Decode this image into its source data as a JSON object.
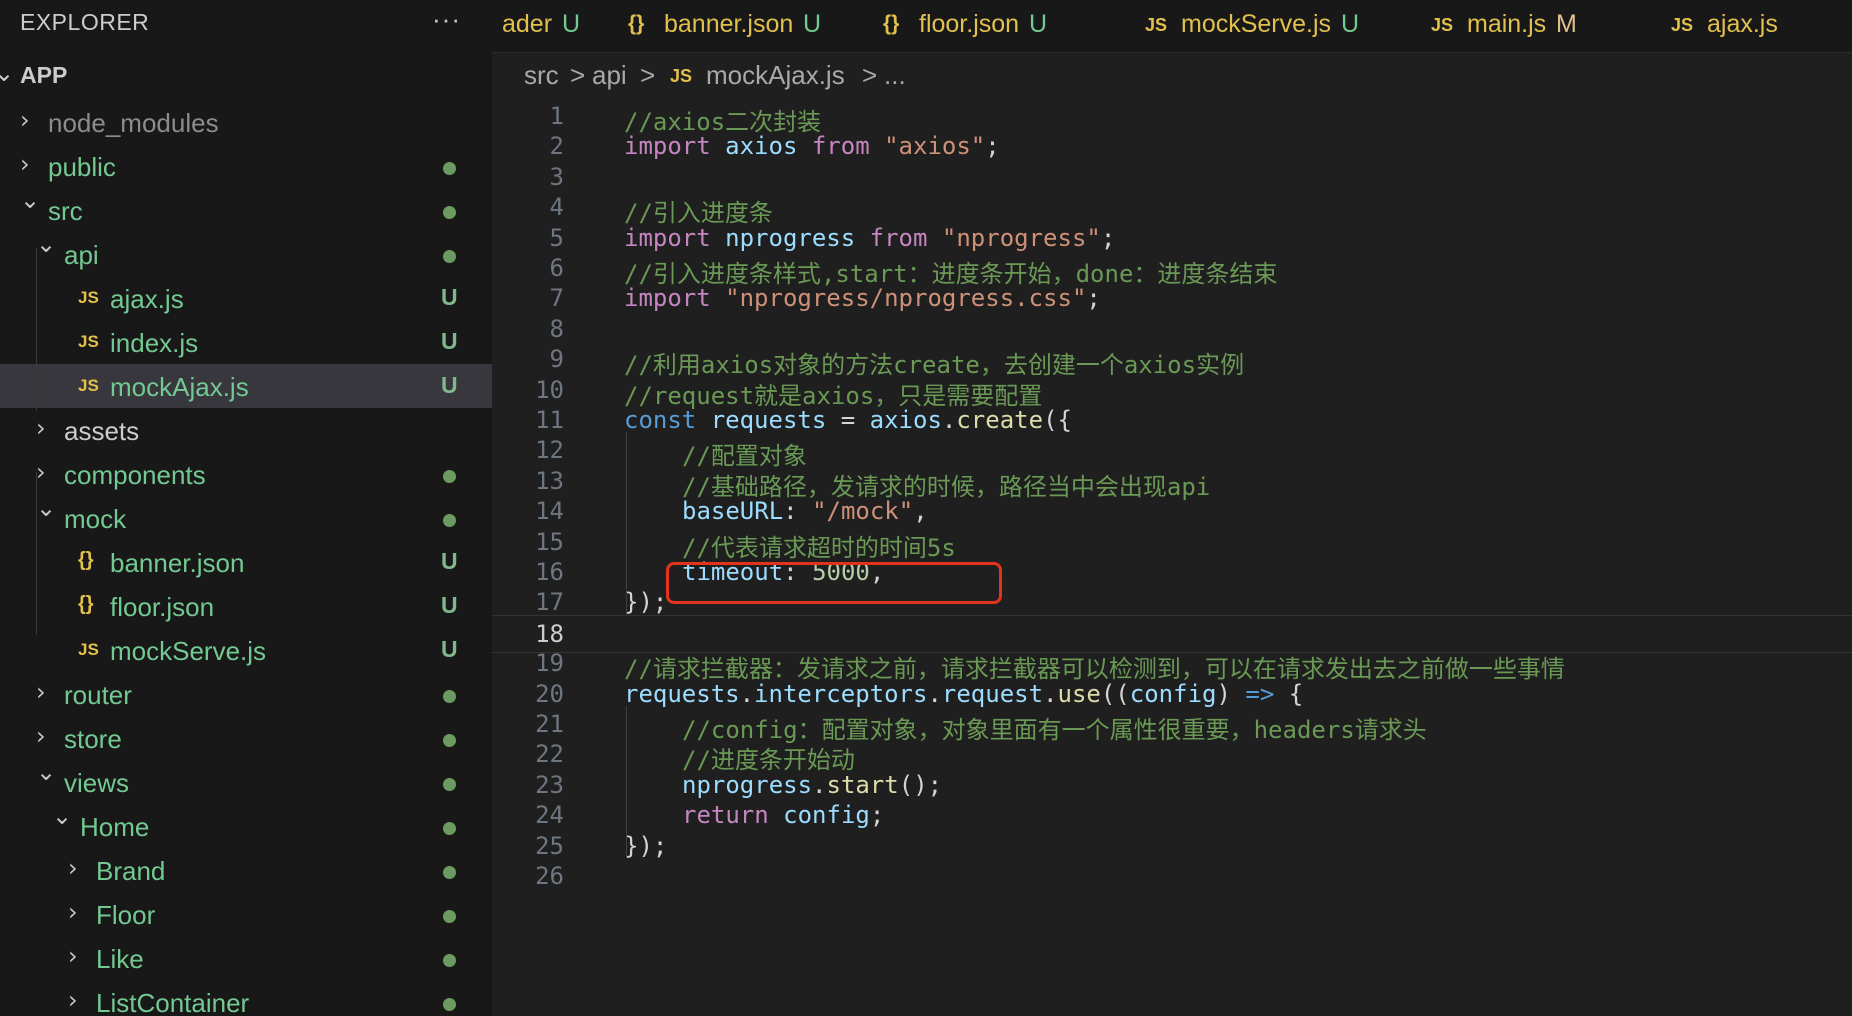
{
  "explorer": {
    "title": "EXPLORER",
    "more": "···",
    "root": "APP",
    "items": [
      {
        "label": "node_modules",
        "type": "folder",
        "state": "collapsed",
        "color": "#8c8c8c"
      },
      {
        "label": "public",
        "type": "folder",
        "state": "collapsed",
        "status": "dot",
        "color": "#73c991"
      },
      {
        "label": "src",
        "type": "folder",
        "state": "expanded",
        "status": "dot",
        "color": "#73c991"
      },
      {
        "label": "api",
        "type": "folder",
        "state": "expanded",
        "status": "dot",
        "color": "#73c991"
      },
      {
        "label": "ajax.js",
        "type": "js",
        "icon": "JS",
        "status": "U",
        "color": "#73c991"
      },
      {
        "label": "index.js",
        "type": "js",
        "icon": "JS",
        "status": "U",
        "color": "#73c991"
      },
      {
        "label": "mockAjax.js",
        "type": "js",
        "icon": "JS",
        "status": "U",
        "color": "#73c991",
        "selected": true
      },
      {
        "label": "assets",
        "type": "folder",
        "state": "collapsed",
        "color": "#cccccc"
      },
      {
        "label": "components",
        "type": "folder",
        "state": "collapsed",
        "status": "dot",
        "color": "#73c991"
      },
      {
        "label": "mock",
        "type": "folder",
        "state": "expanded",
        "status": "dot",
        "color": "#73c991"
      },
      {
        "label": "banner.json",
        "type": "json",
        "icon": "{}",
        "status": "U",
        "color": "#73c991"
      },
      {
        "label": "floor.json",
        "type": "json",
        "icon": "{}",
        "status": "U",
        "color": "#73c991"
      },
      {
        "label": "mockServe.js",
        "type": "js",
        "icon": "JS",
        "status": "U",
        "color": "#73c991"
      },
      {
        "label": "router",
        "type": "folder",
        "state": "collapsed",
        "status": "dot",
        "color": "#73c991"
      },
      {
        "label": "store",
        "type": "folder",
        "state": "collapsed",
        "status": "dot",
        "color": "#73c991"
      },
      {
        "label": "views",
        "type": "folder",
        "state": "expanded",
        "status": "dot",
        "color": "#73c991"
      },
      {
        "label": "Home",
        "type": "folder",
        "state": "expanded",
        "status": "dot",
        "color": "#73c991"
      },
      {
        "label": "Brand",
        "type": "folder",
        "state": "collapsed",
        "status": "dot",
        "color": "#73c991"
      },
      {
        "label": "Floor",
        "type": "folder",
        "state": "collapsed",
        "status": "dot",
        "color": "#73c991"
      },
      {
        "label": "Like",
        "type": "folder",
        "state": "collapsed",
        "status": "dot",
        "color": "#73c991"
      },
      {
        "label": "ListContainer",
        "type": "folder",
        "state": "collapsed",
        "status": "dot",
        "color": "#73c991"
      }
    ]
  },
  "tabs": [
    {
      "icon": "",
      "name": "ader",
      "status": "U"
    },
    {
      "icon": "{}",
      "name": "banner.json",
      "status": "U"
    },
    {
      "icon": "{}",
      "name": "floor.json",
      "status": "U"
    },
    {
      "icon": "JS",
      "name": "mockServe.js",
      "status": "U"
    },
    {
      "icon": "JS",
      "name": "main.js",
      "status": "M"
    },
    {
      "icon": "JS",
      "name": "ajax.js",
      "status": ""
    }
  ],
  "breadcrumb": {
    "parts": [
      "src",
      "api",
      "mockAjax.js",
      "..."
    ],
    "separator": ">",
    "file_icon": "JS"
  },
  "editor": {
    "current_line": 18,
    "highlight_line": 14,
    "lines": [
      {
        "n": "1",
        "indent": 0,
        "tokens": [
          [
            "c",
            "//axios二次封装"
          ]
        ]
      },
      {
        "n": "2",
        "indent": 0,
        "tokens": [
          [
            "k",
            "import"
          ],
          [
            "p",
            " "
          ],
          [
            "v",
            "axios"
          ],
          [
            "p",
            " "
          ],
          [
            "k",
            "from"
          ],
          [
            "p",
            " "
          ],
          [
            "s",
            "\"axios\""
          ],
          [
            "p",
            ";"
          ]
        ]
      },
      {
        "n": "3",
        "indent": 0,
        "tokens": []
      },
      {
        "n": "4",
        "indent": 0,
        "tokens": [
          [
            "c",
            "//引入进度条"
          ]
        ]
      },
      {
        "n": "5",
        "indent": 0,
        "tokens": [
          [
            "k",
            "import"
          ],
          [
            "p",
            " "
          ],
          [
            "v",
            "nprogress"
          ],
          [
            "p",
            " "
          ],
          [
            "k",
            "from"
          ],
          [
            "p",
            " "
          ],
          [
            "s",
            "\"nprogress\""
          ],
          [
            "p",
            ";"
          ]
        ]
      },
      {
        "n": "6",
        "indent": 0,
        "tokens": [
          [
            "c",
            "//引入进度条样式,start：进度条开始，done：进度条结束"
          ]
        ]
      },
      {
        "n": "7",
        "indent": 0,
        "tokens": [
          [
            "k",
            "import"
          ],
          [
            "p",
            " "
          ],
          [
            "s",
            "\"nprogress/nprogress.css\""
          ],
          [
            "p",
            ";"
          ]
        ]
      },
      {
        "n": "8",
        "indent": 0,
        "tokens": []
      },
      {
        "n": "9",
        "indent": 0,
        "tokens": [
          [
            "c",
            "//利用axios对象的方法create，去创建一个axios实例"
          ]
        ]
      },
      {
        "n": "10",
        "indent": 0,
        "tokens": [
          [
            "c",
            "//request就是axios，只是需要配置"
          ]
        ]
      },
      {
        "n": "11",
        "indent": 0,
        "tokens": [
          [
            "d",
            "const"
          ],
          [
            "p",
            " "
          ],
          [
            "v",
            "requests"
          ],
          [
            "p",
            " = "
          ],
          [
            "v",
            "axios"
          ],
          [
            "p",
            "."
          ],
          [
            "f",
            "create"
          ],
          [
            "p",
            "({"
          ]
        ]
      },
      {
        "n": "12",
        "indent": 1,
        "tokens": [
          [
            "c",
            "//配置对象"
          ]
        ]
      },
      {
        "n": "13",
        "indent": 1,
        "tokens": [
          [
            "c",
            "//基础路径，发请求的时候，路径当中会出现api"
          ]
        ]
      },
      {
        "n": "14",
        "indent": 1,
        "tokens": [
          [
            "v",
            "baseURL"
          ],
          [
            "p",
            ": "
          ],
          [
            "s",
            "\"/mock\""
          ],
          [
            "p",
            ","
          ]
        ]
      },
      {
        "n": "15",
        "indent": 1,
        "tokens": [
          [
            "c",
            "//代表请求超时的时间5s"
          ]
        ]
      },
      {
        "n": "16",
        "indent": 1,
        "tokens": [
          [
            "v",
            "timeout"
          ],
          [
            "p",
            ": "
          ],
          [
            "n",
            "5000"
          ],
          [
            "p",
            ","
          ]
        ]
      },
      {
        "n": "17",
        "indent": 0,
        "tokens": [
          [
            "p",
            "});"
          ]
        ]
      },
      {
        "n": "18",
        "indent": 0,
        "tokens": []
      },
      {
        "n": "19",
        "indent": 0,
        "tokens": [
          [
            "c",
            "//请求拦截器：发请求之前，请求拦截器可以检测到，可以在请求发出去之前做一些事情"
          ]
        ]
      },
      {
        "n": "20",
        "indent": 0,
        "tokens": [
          [
            "v",
            "requests"
          ],
          [
            "p",
            "."
          ],
          [
            "v",
            "interceptors"
          ],
          [
            "p",
            "."
          ],
          [
            "v",
            "request"
          ],
          [
            "p",
            "."
          ],
          [
            "f",
            "use"
          ],
          [
            "p",
            "(("
          ],
          [
            "v",
            "config"
          ],
          [
            "p",
            ") "
          ],
          [
            "d",
            "=>"
          ],
          [
            "p",
            " {"
          ]
        ]
      },
      {
        "n": "21",
        "indent": 1,
        "tokens": [
          [
            "c",
            "//config：配置对象，对象里面有一个属性很重要，headers请求头"
          ]
        ]
      },
      {
        "n": "22",
        "indent": 1,
        "tokens": [
          [
            "c",
            "//进度条开始动"
          ]
        ]
      },
      {
        "n": "23",
        "indent": 1,
        "tokens": [
          [
            "v",
            "nprogress"
          ],
          [
            "p",
            "."
          ],
          [
            "f",
            "start"
          ],
          [
            "p",
            "();"
          ]
        ]
      },
      {
        "n": "24",
        "indent": 1,
        "tokens": [
          [
            "k",
            "return"
          ],
          [
            "p",
            " "
          ],
          [
            "v",
            "config"
          ],
          [
            "p",
            ";"
          ]
        ]
      },
      {
        "n": "25",
        "indent": 0,
        "tokens": [
          [
            "p",
            "});"
          ]
        ]
      },
      {
        "n": "26",
        "indent": 0,
        "tokens": []
      }
    ]
  }
}
